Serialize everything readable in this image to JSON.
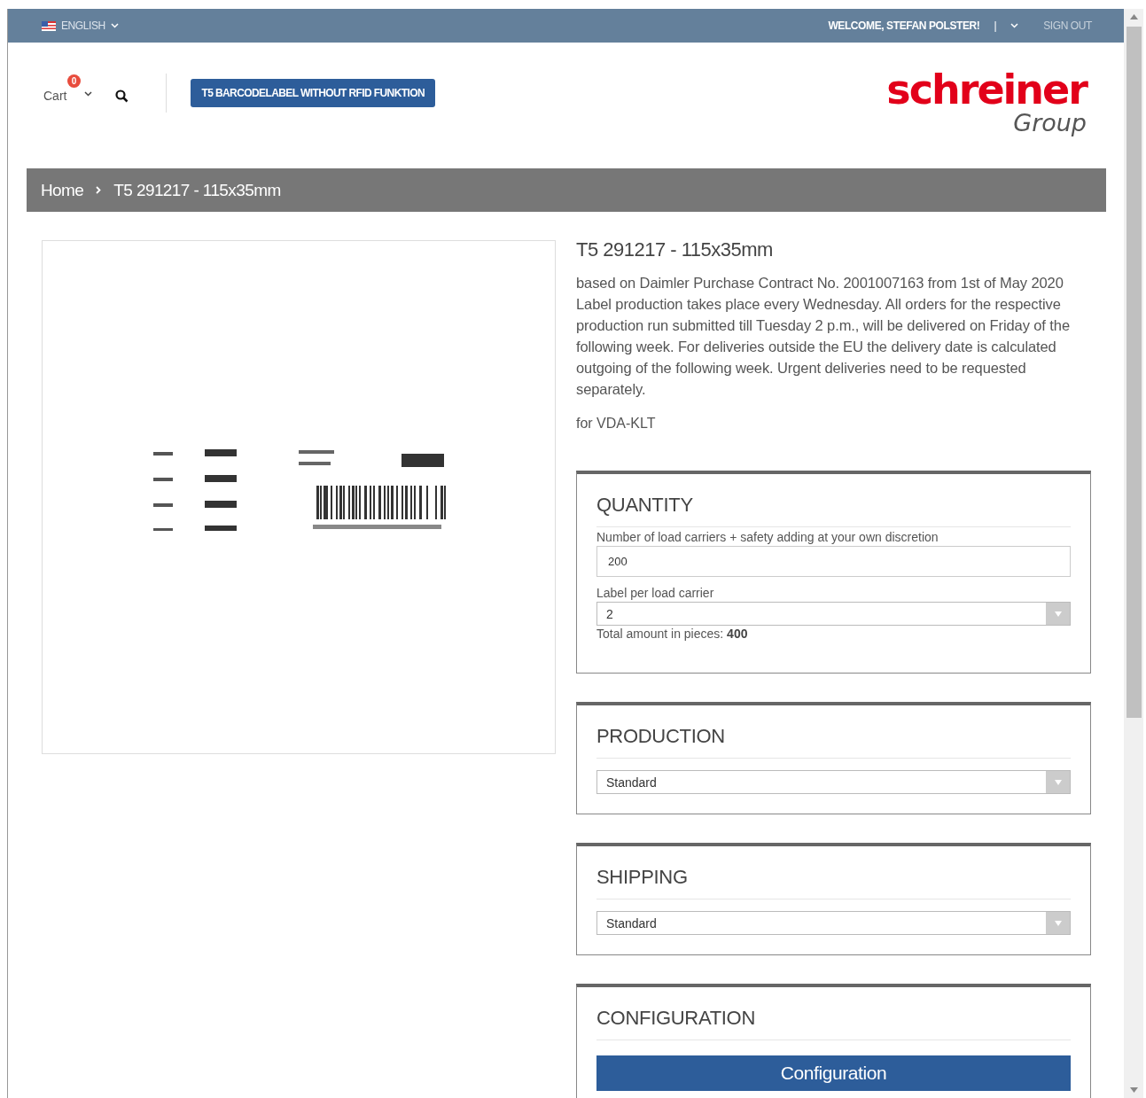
{
  "top_bar": {
    "language": "ENGLISH",
    "welcome": "WELCOME, STEFAN POLSTER!",
    "separator": "|",
    "sign_out": "SIGN OUT"
  },
  "header": {
    "cart_label": "Cart",
    "cart_count": "0",
    "product_button": "T5 BARCODELABEL WITHOUT RFID FUNKTION",
    "logo": {
      "word": "schreiner",
      "sub": "Group"
    }
  },
  "breadcrumb": [
    {
      "label": "Home"
    },
    {
      "label": "T5 291217 - 115x35mm"
    }
  ],
  "product": {
    "title": "T5 291217 - 115x35mm",
    "description": "based on Daimler Purchase Contract No. 2001007163 from 1st of May 2020\nLabel production takes place every Wednesday. All orders for the respective production run submitted till Tuesday 2 p.m., will be delivered on Friday of the following week. For deliveries outside the EU the delivery date is calculated outgoing of the following week. Urgent deliveries need to be requested separately.",
    "note": "for VDA-KLT"
  },
  "panels": [
    {
      "title": "QUANTITY",
      "fields": [
        {
          "kind": "input",
          "label": "Number of load carriers + safety adding at your own discretion",
          "value": "200"
        },
        {
          "kind": "select",
          "label": "Label per load carrier",
          "value": "2"
        }
      ],
      "total": "Total amount in pieces: **400**"
    },
    {
      "title": "PRODUCTION",
      "fields": [
        {
          "kind": "select",
          "value": "Standard"
        }
      ]
    },
    {
      "title": "SHIPPING",
      "fields": [
        {
          "kind": "select",
          "value": "Standard"
        }
      ]
    },
    {
      "title": "CONFIGURATION",
      "fields": [
        {
          "kind": "button",
          "value": "Configuration"
        }
      ]
    }
  ]
}
